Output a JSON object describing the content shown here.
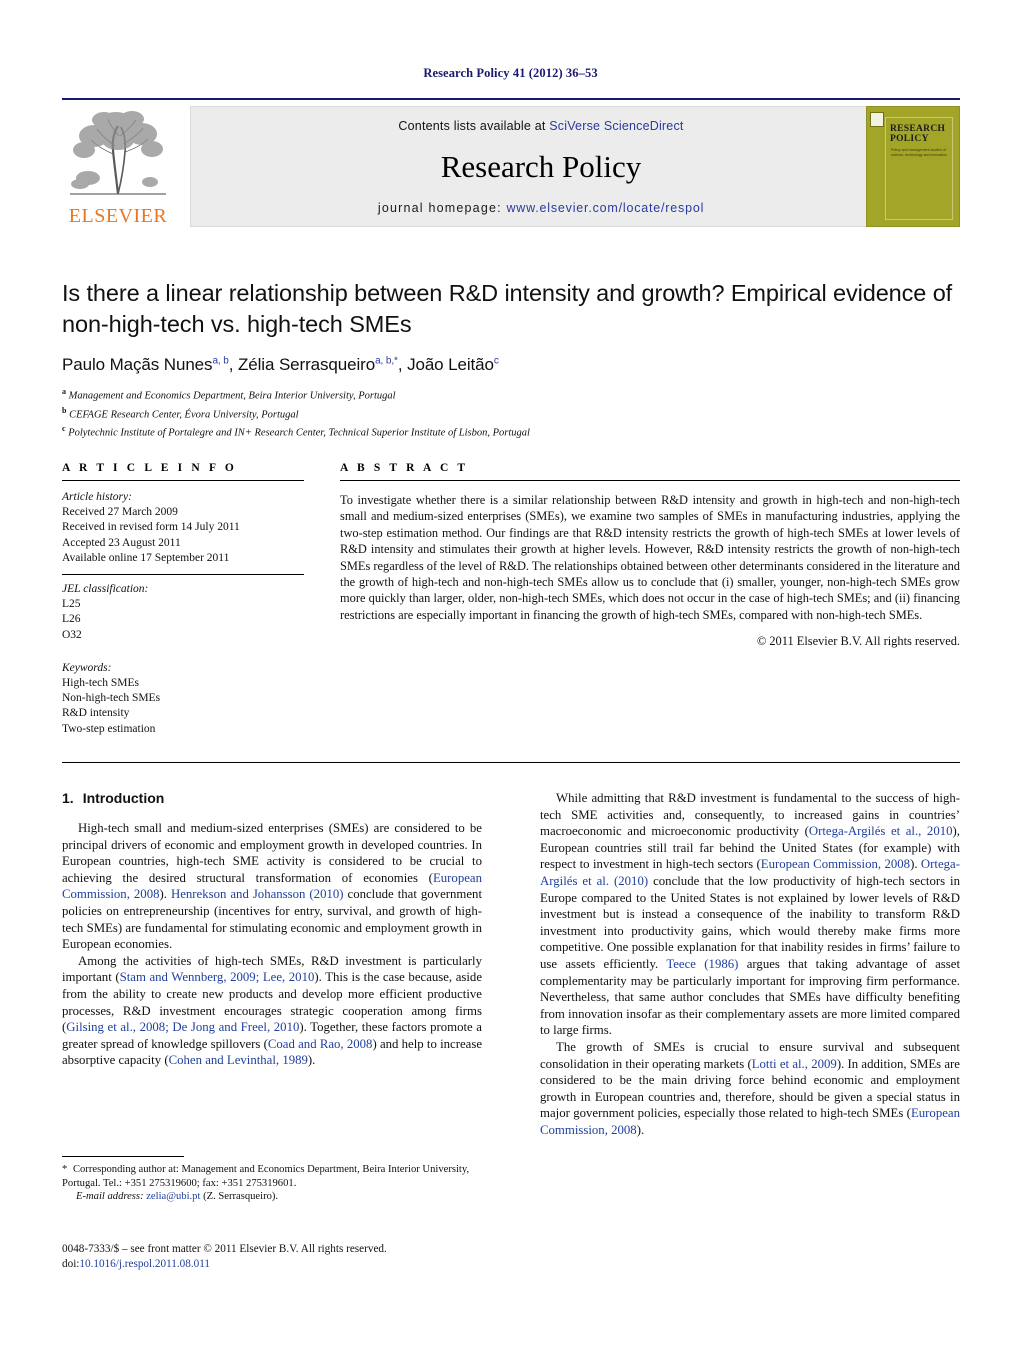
{
  "running_head": "Research Policy 41 (2012) 36–53",
  "masthead": {
    "contents_prefix": "Contents lists available at ",
    "contents_link": "SciVerse ScienceDirect",
    "journal_name": "Research Policy",
    "homepage_label": "journal homepage: ",
    "homepage_url": "www.elsevier.com/locate/respol",
    "publisher_wordmark": "ELSEVIER",
    "publisher_accent_color": "#E87722",
    "cover": {
      "title_line1": "RESEARCH",
      "title_line2": "POLICY",
      "subtitle": "Policy and management studies of science, technology and innovation",
      "background_color": "#a3a528"
    }
  },
  "article": {
    "title": "Is there a linear relationship between R&D intensity and growth? Empirical evidence of non-high-tech vs. high-tech SMEs",
    "authors": [
      {
        "name": "Paulo Maçãs Nunes",
        "marks": "a, b",
        "sep": ", "
      },
      {
        "name": "Zélia Serrasqueiro",
        "marks": "a, b,*",
        "sep": ", "
      },
      {
        "name": "João Leitão",
        "marks": "c",
        "sep": ""
      }
    ],
    "affiliations": [
      {
        "mark": "a",
        "text": "Management and Economics Department, Beira Interior University, Portugal"
      },
      {
        "mark": "b",
        "text": "CEFAGE Research Center, Évora University, Portugal"
      },
      {
        "mark": "c",
        "text": "Polytechnic Institute of Portalegre and IN+ Research Center, Technical Superior Institute of Lisbon, Portugal"
      }
    ]
  },
  "article_info": {
    "heading": "A R T I C L E   I N F O",
    "history_label": "Article history:",
    "history": [
      "Received 27 March 2009",
      "Received in revised form 14 July 2011",
      "Accepted 23 August 2011",
      "Available online 17 September 2011"
    ],
    "jel_label": "JEL classification:",
    "jel_codes": [
      "L25",
      "L26",
      "O32"
    ],
    "keywords_label": "Keywords:",
    "keywords": [
      "High-tech SMEs",
      "Non-high-tech SMEs",
      "R&D intensity",
      "Two-step estimation"
    ]
  },
  "abstract": {
    "heading": "A B S T R A C T",
    "text": "To investigate whether there is a similar relationship between R&D intensity and growth in high-tech and non-high-tech small and medium-sized enterprises (SMEs), we examine two samples of SMEs in manufacturing industries, applying the two-step estimation method. Our findings are that R&D intensity restricts the growth of high-tech SMEs at lower levels of R&D intensity and stimulates their growth at higher levels. However, R&D intensity restricts the growth of non-high-tech SMEs regardless of the level of R&D. The relationships obtained between other determinants considered in the literature and the growth of high-tech and non-high-tech SMEs allow us to conclude that (i) smaller, younger, non-high-tech SMEs grow more quickly than larger, older, non-high-tech SMEs, which does not occur in the case of high-tech SMEs; and (ii) financing restrictions are especially important in financing the growth of high-tech SMEs, compared with non-high-tech SMEs.",
    "copyright": "© 2011 Elsevier B.V. All rights reserved."
  },
  "introduction": {
    "number": "1.",
    "title": "Introduction",
    "left_paragraphs": [
      [
        {
          "t": "High-tech small and medium-sized enterprises (SMEs) are considered to be principal drivers of economic and employment growth in developed countries. In European countries, high-tech SME activity is considered to be crucial to achieving the desired structural transformation of economies ("
        },
        {
          "t": "European Commission, 2008",
          "ref": true
        },
        {
          "t": "). "
        },
        {
          "t": "Henrekson and Johansson (2010)",
          "ref": true
        },
        {
          "t": " conclude that government policies on entrepreneurship (incentives for entry, survival, and growth of high-tech SMEs) are fundamental for stimulating economic and employment growth in European economies."
        }
      ],
      [
        {
          "t": "Among the activities of high-tech SMEs, R&D investment is particularly important ("
        },
        {
          "t": "Stam and Wennberg, 2009; Lee, 2010",
          "ref": true
        },
        {
          "t": "). This is the case because, aside from the ability to create new products and develop more efficient productive processes, R&D investment encourages strategic cooperation among firms ("
        },
        {
          "t": "Gilsing et al., 2008; De Jong and Freel, 2010",
          "ref": true
        },
        {
          "t": "). Together, these factors promote a greater spread of knowledge spillovers ("
        },
        {
          "t": "Coad and Rao, 2008",
          "ref": true
        },
        {
          "t": ") and help to increase absorptive capacity ("
        },
        {
          "t": "Cohen and Levinthal, 1989",
          "ref": true
        },
        {
          "t": ")."
        }
      ]
    ],
    "right_paragraphs": [
      [
        {
          "t": "While admitting that R&D investment is fundamental to the success of high-tech SME activities and, consequently, to increased gains in countries’ macroeconomic and microeconomic productivity ("
        },
        {
          "t": "Ortega-Argilés et al., 2010",
          "ref": true
        },
        {
          "t": "), European countries still trail far behind the United States (for example) with respect to investment in high-tech sectors ("
        },
        {
          "t": "European Commission, 2008",
          "ref": true
        },
        {
          "t": "). "
        },
        {
          "t": "Ortega-Argilés et al. (2010)",
          "ref": true
        },
        {
          "t": " conclude that the low productivity of high-tech sectors in Europe compared to the United States is not explained by lower levels of R&D investment but is instead a consequence of the inability to transform R&D investment into productivity gains, which would thereby make firms more competitive. One possible explanation for that inability resides in firms’ failure to use assets efficiently. "
        },
        {
          "t": "Teece (1986)",
          "ref": true
        },
        {
          "t": " argues that taking advantage of asset complementarity may be particularly important for improving firm performance. Nevertheless, that same author concludes that SMEs have difficulty benefiting from innovation insofar as their complementary assets are more limited compared to large firms."
        }
      ],
      [
        {
          "t": "The growth of SMEs is crucial to ensure survival and subsequent consolidation in their operating markets ("
        },
        {
          "t": "Lotti et al., 2009",
          "ref": true
        },
        {
          "t": "). In addition, SMEs are considered to be the main driving force behind economic and employment growth in European countries and, therefore, should be given a special status in major government policies, especially those related to high-tech SMEs ("
        },
        {
          "t": "European Commission, 2008",
          "ref": true
        },
        {
          "t": ")."
        }
      ]
    ]
  },
  "footnote": {
    "star": "*",
    "corresponding": " Corresponding author at: Management and Economics Department, Beira Interior University, Portugal. Tel.: +351 275319600; fax: +351 275319601.",
    "email_label": "E-mail address:",
    "email": "zelia@ubi.pt",
    "email_owner": " (Z. Serrasqueiro)."
  },
  "imprint": {
    "line1": "0048-7333/$ – see front matter © 2011 Elsevier B.V. All rights reserved.",
    "doi_label": "doi:",
    "doi": "10.1016/j.respol.2011.08.011"
  }
}
